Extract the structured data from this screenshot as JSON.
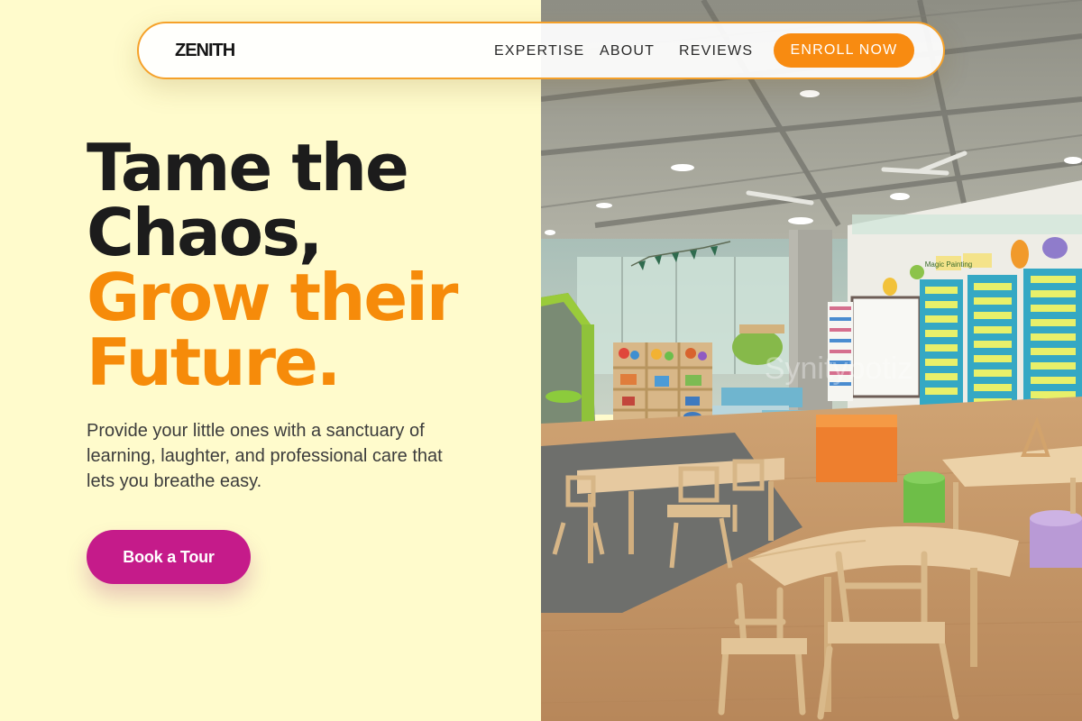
{
  "brand": {
    "logo_text": "ZENITH"
  },
  "nav": {
    "links": [
      "EXPERTISE",
      "ABOUT",
      "REVIEWS"
    ],
    "cta_label": "ENROLL NOW"
  },
  "hero": {
    "headline_lines": [
      "Tame the",
      "Chaos,",
      "Grow their",
      "Future."
    ],
    "subtext": "Provide your little ones with a sanctuary of learning, laughter, and professional care that lets you breathe easy.",
    "cta_label": "Book a Tour"
  },
  "photo": {
    "wall_sign": "Magic Painting",
    "watermark": "Synitybotiz"
  },
  "colors": {
    "background": "#FFFBCC",
    "accent_orange": "#F68B0A",
    "tour_button": "#C51B8A",
    "nav_border": "#F5A12A"
  }
}
